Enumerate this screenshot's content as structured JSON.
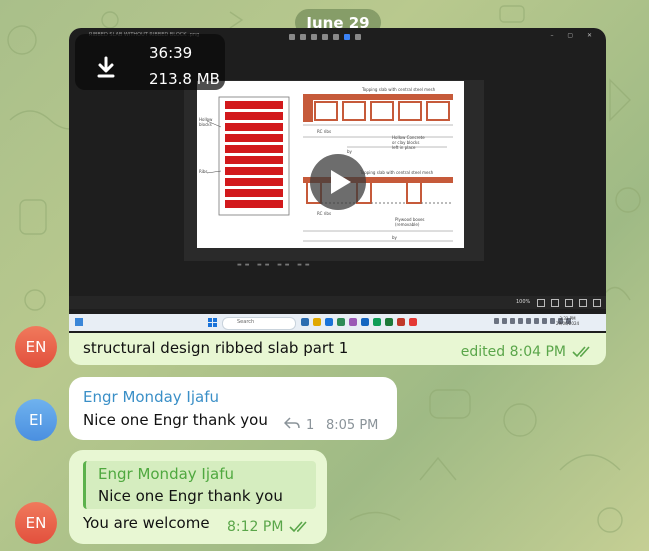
{
  "date_separator": "June 29",
  "video_message": {
    "duration": "36:39",
    "file_size": "213.8 MB",
    "download_icon": "download-arrow-icon",
    "play_icon": "play-icon",
    "caption": "structural design ribbed slab part 1",
    "edited_time": "edited 8:04 PM",
    "status_icon": "double-check-icon",
    "viewer_zoom": "100%"
  },
  "messages": [
    {
      "avatar_initials": "EN",
      "avatar_color": "#e2503d"
    },
    {
      "avatar_initials": "EI",
      "avatar_color": "#4a8fe0",
      "sender": "Engr Monday Ijafu",
      "text": "Nice one Engr thank you",
      "reply_icon": "reply-arrow-icon",
      "reply_count": "1",
      "time": "8:05 PM"
    },
    {
      "avatar_initials": "EN",
      "avatar_color": "#e2503d",
      "quote_sender": "Engr Monday Ijafu",
      "quote_text": "Nice one Engr thank you",
      "text": "You are welcome",
      "time": "8:12 PM",
      "status_icon": "double-check-icon"
    }
  ],
  "colors": {
    "outgoing_bubble": "#e8f7d3",
    "incoming_bubble": "#ffffff",
    "sender_name": "#3a8fc7",
    "accent_green": "#5aa64a"
  }
}
